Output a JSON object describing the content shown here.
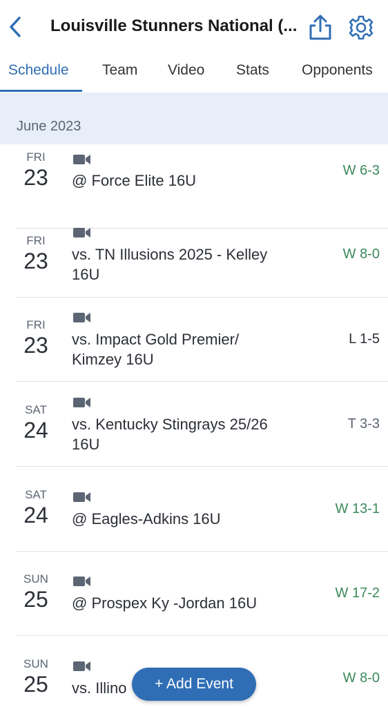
{
  "header": {
    "title": "Louisville Stunners National (...",
    "back_icon": "chevron-left-icon",
    "share_icon": "share-icon",
    "settings_icon": "gear-icon",
    "accent_color": "#2f6eb5"
  },
  "tabs": [
    {
      "label": "Schedule",
      "active": true
    },
    {
      "label": "Team"
    },
    {
      "label": "Video"
    },
    {
      "label": "Stats"
    },
    {
      "label": "Opponents"
    }
  ],
  "schedule": {
    "month": "June 2023",
    "events": [
      {
        "dow": "FRI",
        "day": "23",
        "opponent": "@ Force Elite 16U",
        "result": "W 6-3",
        "result_type": "win",
        "icon": "video-camera-icon"
      },
      {
        "dow": "FRI",
        "day": "23",
        "opponent": "vs. TN Illusions 2025 - Kelley 16U",
        "result": "W 8-0",
        "result_type": "win",
        "icon": "video-camera-icon"
      },
      {
        "dow": "FRI",
        "day": "23",
        "opponent": "vs. Impact Gold Premier/ Kimzey 16U",
        "result": "L 1-5",
        "result_type": "loss",
        "icon": "video-camera-icon"
      },
      {
        "dow": "SAT",
        "day": "24",
        "opponent": "vs. Kentucky Stingrays 25/26 16U",
        "result": "T 3-3",
        "result_type": "tie",
        "icon": "video-camera-icon"
      },
      {
        "dow": "SAT",
        "day": "24",
        "opponent": "@ Eagles-Adkins 16U",
        "result": "W 13-1",
        "result_type": "win",
        "icon": "video-camera-icon"
      },
      {
        "dow": "SUN",
        "day": "25",
        "opponent": "@ Prospex Ky -Jordan 16U",
        "result": "W 17-2",
        "result_type": "win",
        "icon": "video-camera-icon"
      },
      {
        "dow": "SUN",
        "day": "25",
        "opponent": "vs. Illino",
        "result": "W 8-0",
        "result_type": "win",
        "icon": "video-camera-icon"
      }
    ]
  },
  "add_event_button": "+ Add Event"
}
